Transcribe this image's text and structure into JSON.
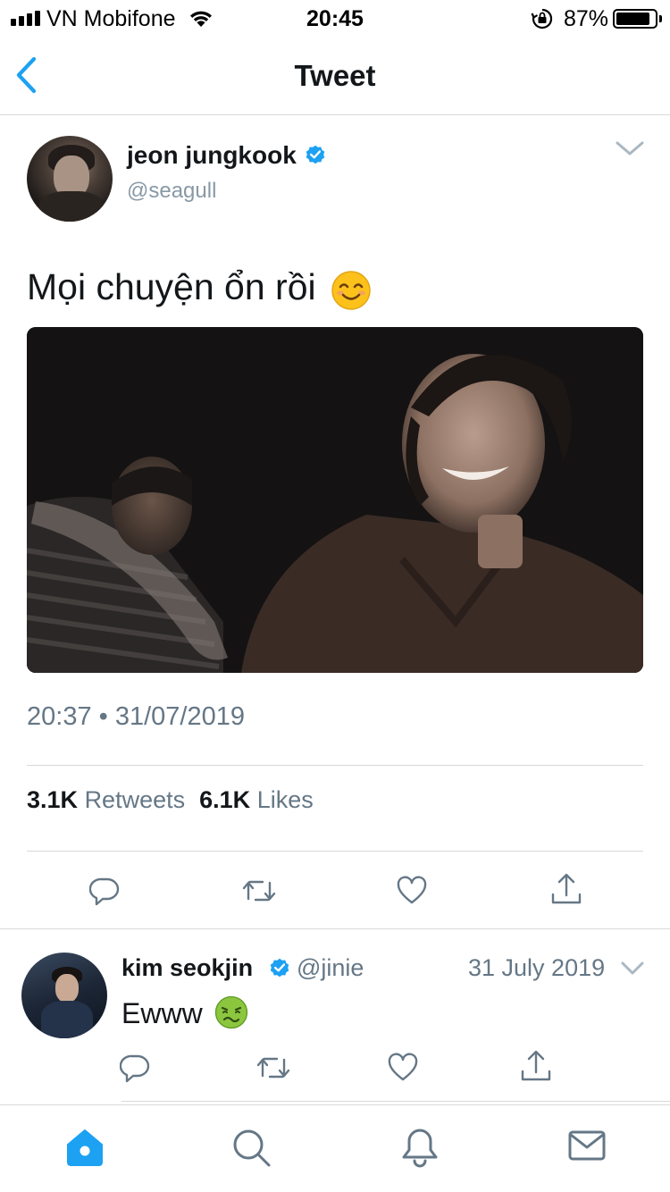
{
  "status_bar": {
    "carrier": "VN Mobifone",
    "time": "20:45",
    "battery_percent": "87%",
    "battery_level": 0.87,
    "signal_icon": "signal-bars-icon",
    "wifi_icon": "wifi-icon",
    "orientation_lock_icon": "orientation-lock-icon"
  },
  "nav": {
    "title": "Tweet",
    "back_icon": "chevron-left-icon",
    "accent_color": "#1da1f2"
  },
  "tweet": {
    "display_name": "jeon jungkook",
    "handle": "@seagull",
    "verified": true,
    "text": "Mọi chuyện ổn rồi",
    "emoji": "smiling-face-emoji",
    "timestamp": "20:37 • 31/07/2019",
    "stats": {
      "retweets_count": "3.1K",
      "retweets_label": "Retweets",
      "likes_count": "6.1K",
      "likes_label": "Likes"
    },
    "actions": [
      "reply-icon",
      "retweet-icon",
      "like-icon",
      "share-icon"
    ]
  },
  "reply": {
    "display_name": "kim seokjin",
    "handle": "@jinie",
    "verified": true,
    "date": "31 July 2019",
    "text": "Ewww",
    "emoji": "nauseated-face-emoji",
    "actions": [
      "reply-icon",
      "retweet-icon",
      "like-icon",
      "share-icon"
    ]
  },
  "tab_bar": {
    "tabs": [
      "home-icon",
      "search-icon",
      "notifications-icon",
      "messages-icon"
    ],
    "active": "home-icon"
  },
  "colors": {
    "verified_blue": "#1da1f2",
    "secondary_text": "#657786",
    "icon_gray": "#657786"
  }
}
